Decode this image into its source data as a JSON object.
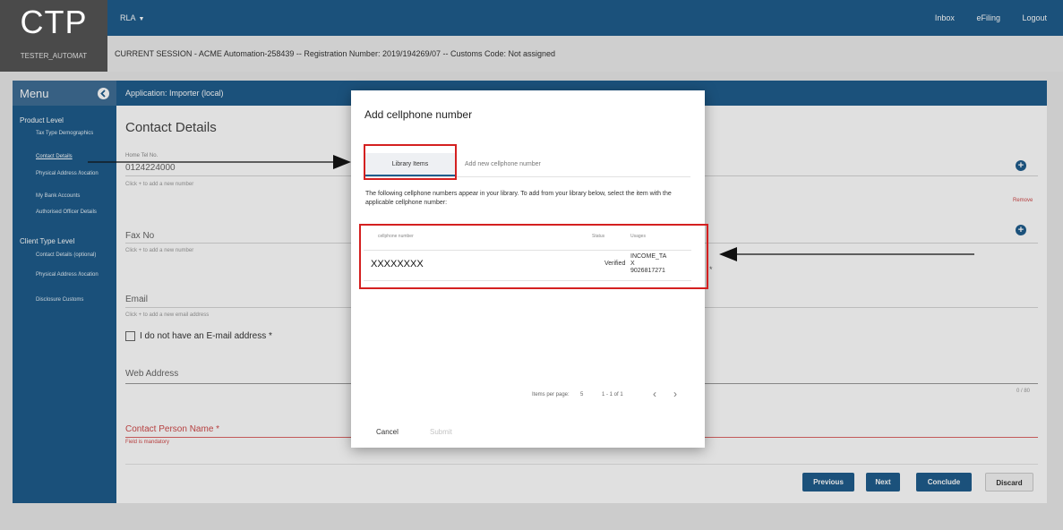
{
  "header": {
    "logo": "CTP",
    "user": "TESTER_AUTOMAT",
    "rla_menu": "RLA",
    "nav": [
      "Inbox",
      "eFiling",
      "Logout"
    ],
    "session": "CURRENT SESSION - ACME Automation-258439 -- Registration Number: 2019/194269/07 -- Customs Code: Not assigned"
  },
  "sidebar": {
    "title": "Menu",
    "groups": [
      {
        "label": "Product Level"
      },
      {
        "label": "Client Type Level"
      }
    ],
    "items": [
      {
        "label": "Tax Type Demographics"
      },
      {
        "label": "Contact Details"
      },
      {
        "label": "Physical Address /location"
      },
      {
        "label": "My Bank Accounts"
      },
      {
        "label": "Authorised Officer Details"
      },
      {
        "label": "Contact Details (optional)"
      },
      {
        "label": "Physical Address /location"
      },
      {
        "label": "Disclosure Customs"
      }
    ]
  },
  "content": {
    "application": "Application: Importer (local)",
    "title": "Contact Details",
    "home_tel_label": "Home Tel No.",
    "home_tel_value": "0124224000",
    "add_number_hint": "Click + to add a new number",
    "remove": "Remove",
    "fax_label": "Fax No",
    "fax_hint": "Click + to add a new number",
    "email_label": "Email",
    "email_hint": "Click + to add a new email address",
    "no_email_checkbox": "I do not have an E-mail address *",
    "web_label": "Web Address",
    "web_counter": "0 / 80",
    "contact_person_label": "Contact Person Name *",
    "field_mandatory": "Field is mandatory",
    "partial_asterisk": "*",
    "buttons": {
      "previous": "Previous",
      "next": "Next",
      "conclude": "Conclude",
      "discard": "Discard"
    }
  },
  "modal": {
    "title": "Add cellphone number",
    "tabs": [
      "Library Items",
      "Add new cellphone number"
    ],
    "description": "The following cellphone numbers appear in your library. To add from your library below, select the item with the applicable cellphone number:",
    "columns": [
      "cellphone number",
      "Status",
      "Usages"
    ],
    "rows": [
      {
        "number": "XXXXXXXX",
        "status": "Verified",
        "usage_line1": "INCOME_TA",
        "usage_line2": "X",
        "usage_line3": "9026817271"
      }
    ],
    "items_per_page_label": "Items per page:",
    "items_per_page": "5",
    "range": "1 - 1 of 1",
    "prev_icon": "chevron-left-icon",
    "next_icon": "chevron-right-icon",
    "cancel": "Cancel",
    "submit": "Submit"
  },
  "colors": {
    "header_blue": "#1f5d8c",
    "sidebar_blue": "#1e5c8b",
    "logo_gray": "#4a4a4a",
    "annotation_red": "#d42020",
    "error_red": "#d04a4a"
  }
}
